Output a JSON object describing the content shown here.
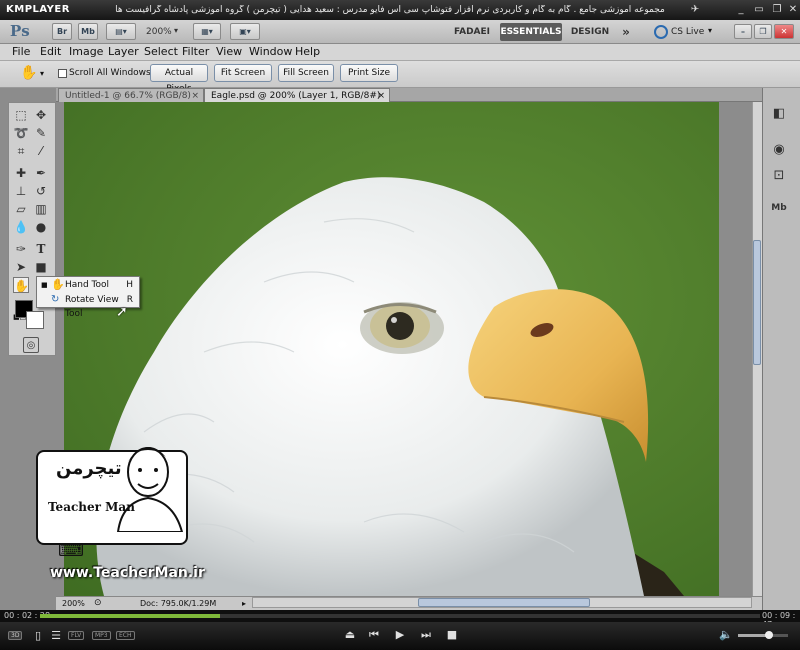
{
  "kmplayer": {
    "logo": "KMPLAYER",
    "title": "مجموعه آموزشی جامع . گام به گام و کاربردی نرم افزار فتوشاپ سی اس فایو   مدرس : سعید هدایی ( تیچرمن ) گروه آموزشی پادشاه گرافیست ها",
    "time_elapsed": "00 : 02 : 28",
    "time_total": "00 : 09 : 47",
    "progress": 0.25,
    "badges": [
      "3D",
      "FLV",
      "MP3",
      "ECH"
    ]
  },
  "appbar": {
    "logo": "Ps",
    "br": "Br",
    "mb": "Mb",
    "zoom": "200%",
    "workspaces": [
      "FADAEI",
      "ESSENTIALS",
      "DESIGN"
    ],
    "more": "»",
    "cs_live": "CS Live"
  },
  "menu": [
    "File",
    "Edit",
    "Image",
    "Layer",
    "Select",
    "Filter",
    "View",
    "Window",
    "Help"
  ],
  "options": {
    "scroll_all_windows": "Scroll All Windows",
    "buttons": [
      "Actual Pixels",
      "Fit Screen",
      "Fill Screen",
      "Print Size"
    ]
  },
  "tabs": [
    {
      "label": "Untitled-1 @ 66.7% (RGB/8)",
      "close": "×"
    },
    {
      "label": "Eagle.psd @ 200% (Layer 1, RGB/8#)",
      "close": "×"
    }
  ],
  "flyout": [
    {
      "label": "Hand Tool",
      "shortcut": "H",
      "active": true
    },
    {
      "label": "Rotate View Tool",
      "shortcut": "R",
      "active": false
    }
  ],
  "status": {
    "zoom": "200%",
    "doc": "Doc: 795.0K/1.29M"
  },
  "watermark": {
    "name": "Teacher Man",
    "url": "www.TeacherMan.ir",
    "logo_text": "تیچرمن"
  },
  "colors": {
    "canvas_green": "#4d7a2a",
    "accent_green": "#7fb93a"
  }
}
